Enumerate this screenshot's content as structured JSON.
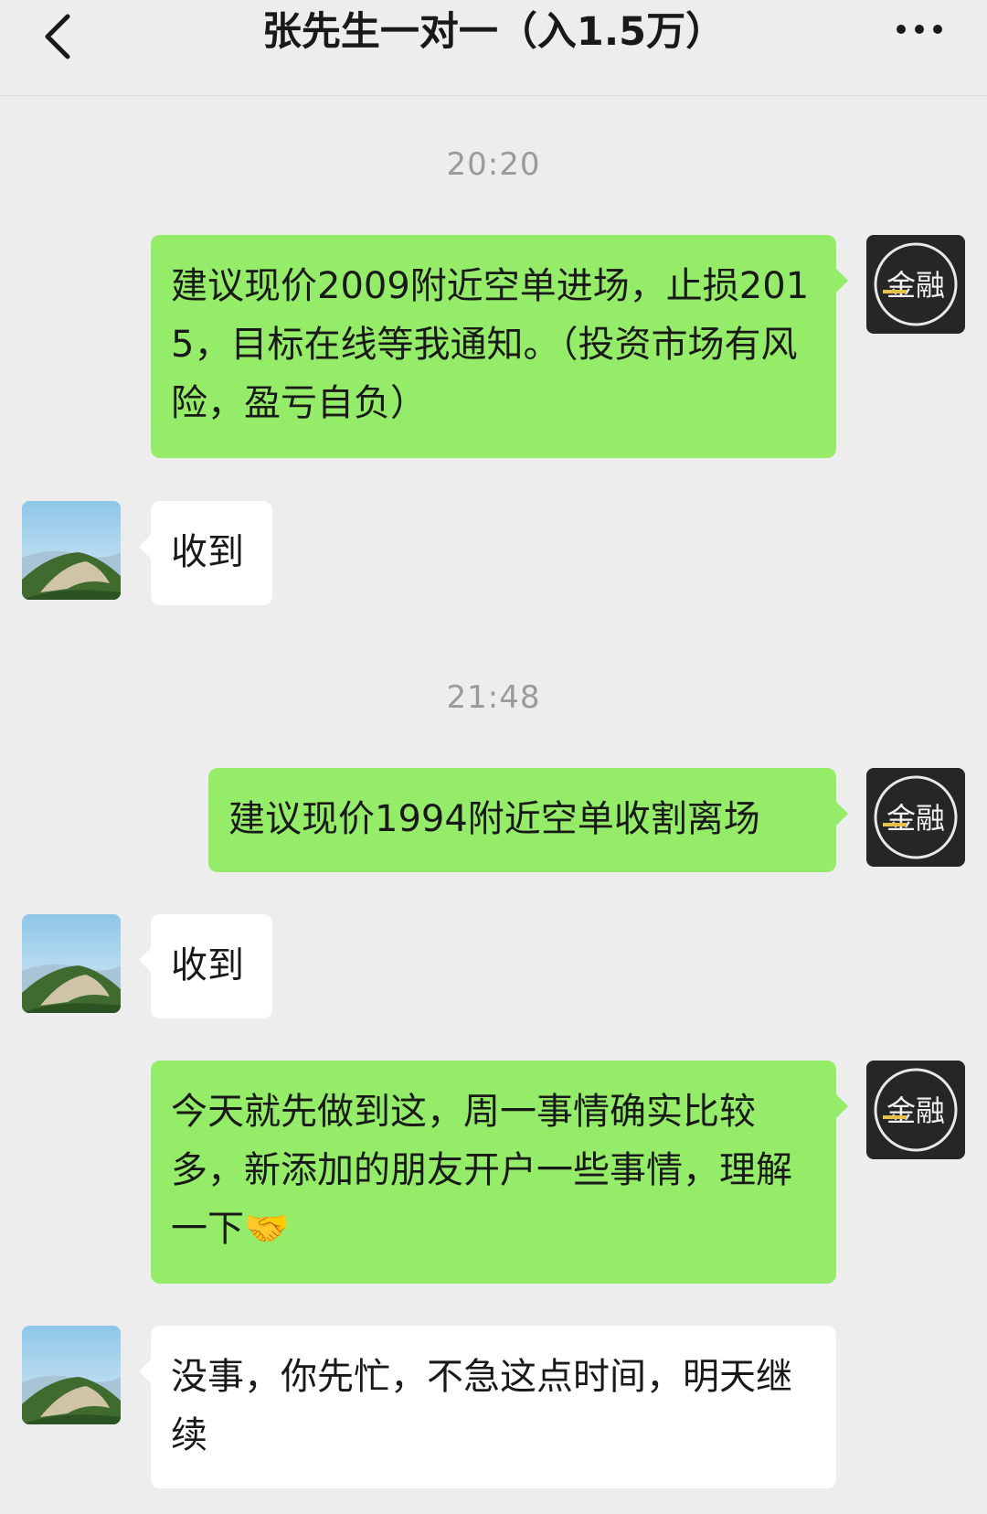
{
  "header": {
    "title": "张先生一对一（入1.5万）",
    "back_icon": "chevron-left-icon",
    "more_icon": "more-dots-icon"
  },
  "self_avatar": {
    "logo_text": "金融"
  },
  "messages": [
    {
      "type": "time",
      "text": "20:20"
    },
    {
      "type": "out",
      "text": "建议现价2009附近空单进场，止损2015，目标在线等我通知。（投资市场有风险，盈亏自负）"
    },
    {
      "type": "in",
      "text": "收到"
    },
    {
      "type": "time",
      "text": "21:48"
    },
    {
      "type": "out",
      "text": "建议现价1994附近空单收割离场"
    },
    {
      "type": "in",
      "text": "收到"
    },
    {
      "type": "out",
      "text": "今天就先做到这，周一事情确实比较多，新添加的朋友开户一些事情，理解一下",
      "emoji": "🤝"
    },
    {
      "type": "in",
      "text": "没事，你先忙，不急这点时间，明天继续"
    }
  ],
  "colors": {
    "background": "#ededed",
    "outgoing_bubble": "#95ec69",
    "incoming_bubble": "#ffffff",
    "timestamp": "#9a9a9a"
  }
}
